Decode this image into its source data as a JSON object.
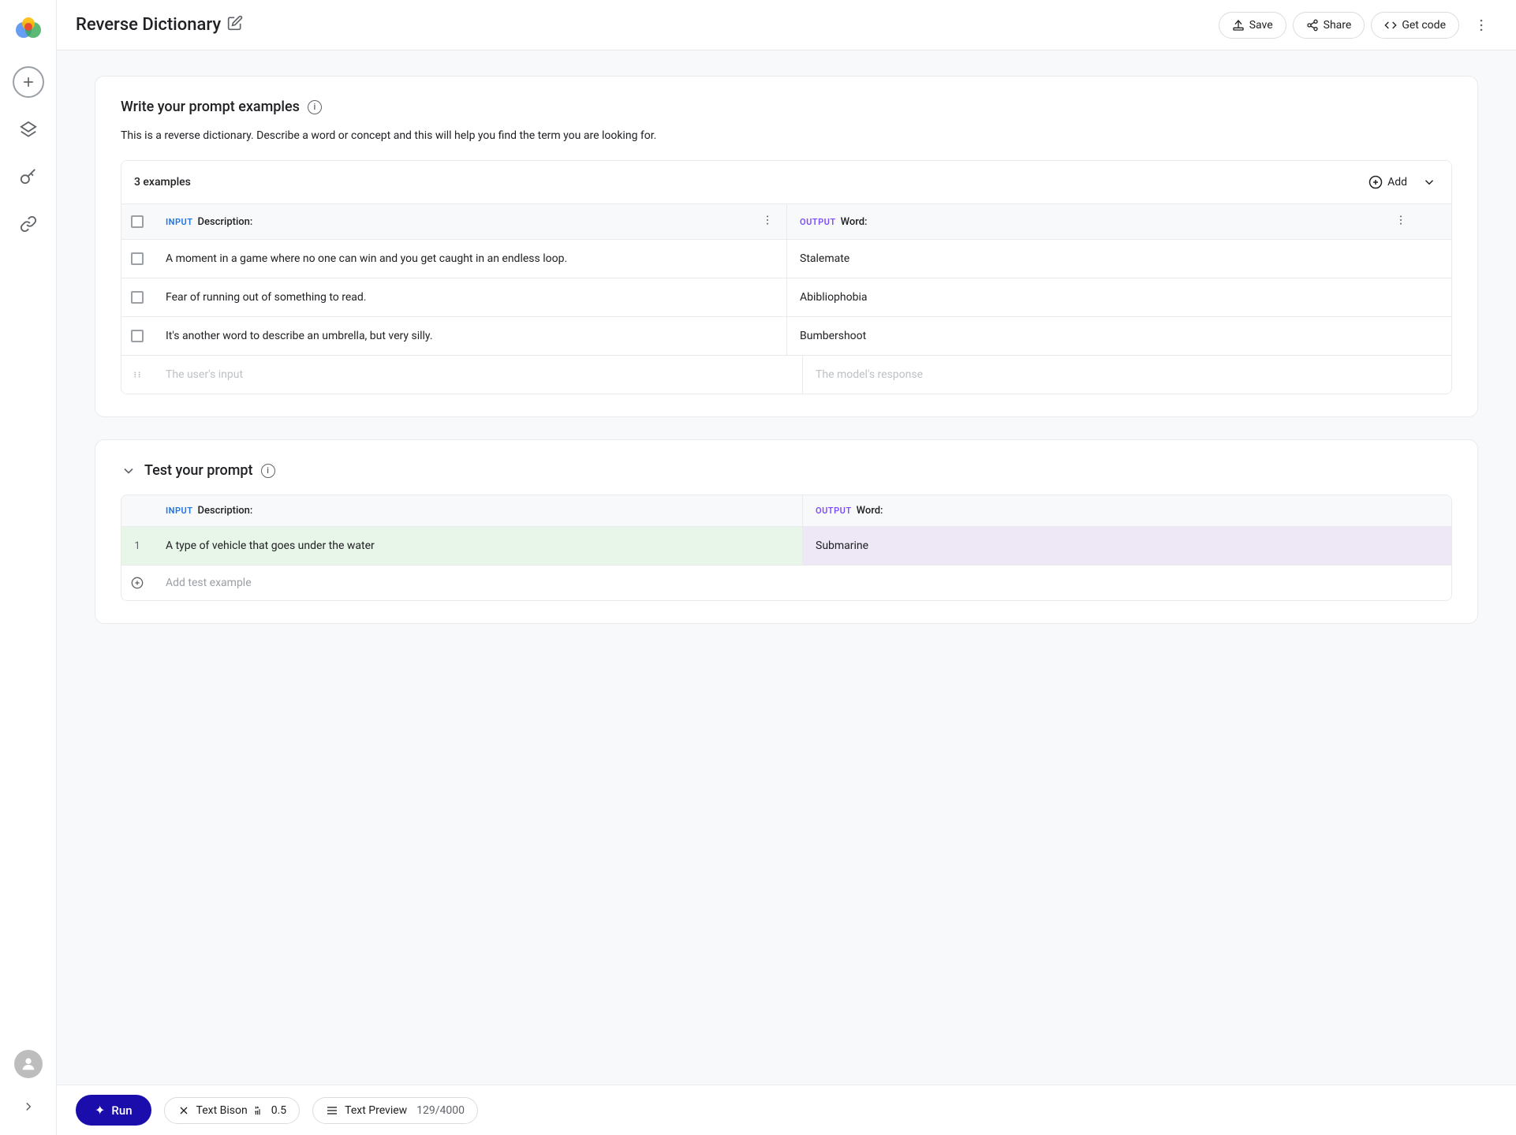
{
  "app": {
    "name": "Reverse Dictionary",
    "logo_icon": "🌸"
  },
  "sidebar": {
    "icons": [
      {
        "name": "add-icon",
        "symbol": "+",
        "type": "circle-add"
      },
      {
        "name": "layers-icon",
        "symbol": "≡",
        "type": "stack"
      },
      {
        "name": "key-icon",
        "symbol": "🔑",
        "type": "key"
      },
      {
        "name": "link-icon",
        "symbol": "🔗",
        "type": "link"
      }
    ],
    "expand_label": ">",
    "avatar_icon": "👤"
  },
  "header": {
    "title": "Reverse Dictionary",
    "edit_icon": "✏️",
    "save_label": "Save",
    "share_label": "Share",
    "get_code_label": "Get code",
    "more_icon": "⋮"
  },
  "prompt_section": {
    "title": "Write your prompt examples",
    "description": "This is a reverse dictionary. Describe a word or concept and this will help you find the term you are looking for.",
    "examples_count": "3 examples",
    "add_label": "Add",
    "input_label": "INPUT",
    "input_col": "Description:",
    "output_label": "OUTPUT",
    "output_col": "Word:",
    "rows": [
      {
        "input": "A moment in a game where no one can win and you get caught in an endless loop.",
        "output": "Stalemate"
      },
      {
        "input": "Fear of running out of something to read.",
        "output": "Abibliophobia"
      },
      {
        "input": "It's another word to describe an umbrella, but very silly.",
        "output": "Bumbershoot"
      }
    ],
    "placeholder_input": "The user's input",
    "placeholder_output": "The model's response"
  },
  "test_section": {
    "title": "Test your prompt",
    "input_label": "INPUT",
    "input_col": "Description:",
    "output_label": "OUTPUT",
    "output_col": "Word:",
    "test_row": {
      "number": "1",
      "input": "A type of vehicle that goes under the water",
      "output": "Submarine"
    },
    "add_example_placeholder": "Add test example"
  },
  "bottom_bar": {
    "run_label": "Run",
    "run_icon": "✦",
    "model_name": "Text Bison",
    "model_icon": "✕",
    "temperature": "0.5",
    "temperature_icon": "⚙",
    "preview_label": "Text Preview",
    "preview_icon": "≡",
    "token_count": "129/4000"
  }
}
